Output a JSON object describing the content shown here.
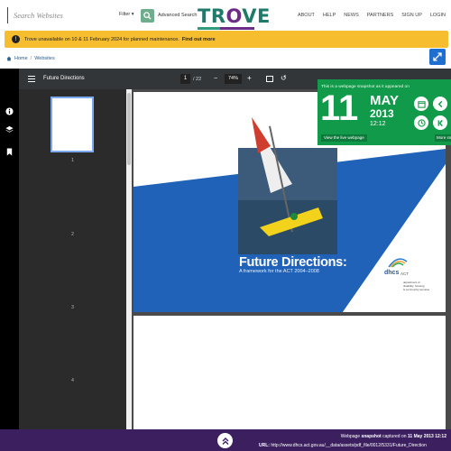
{
  "header": {
    "search_placeholder": "Search Websites",
    "filter_label": "Filter",
    "advanced_search_label": "Advanced Search",
    "logo_left": "TR",
    "logo_o": "O",
    "logo_right": "VE",
    "nav": [
      "ABOUT",
      "HELP",
      "NEWS",
      "PARTNERS",
      "SIGN UP",
      "LOGIN"
    ]
  },
  "alert": {
    "icon": "!",
    "text": "Trove unavailable on 10 & 11 February 2024 for planned maintenance.",
    "link": "Find out more"
  },
  "breadcrumb": {
    "home": "Home",
    "sep": "/",
    "current": "Websites"
  },
  "viewer": {
    "doc_title": "Future Directions",
    "page_current": "1",
    "page_total": "/ 22",
    "zoom": "74%",
    "minus": "−",
    "plus": "+",
    "rotate": "↺",
    "thumb_numbers": [
      "1",
      "2",
      "3",
      "4"
    ]
  },
  "cover": {
    "title": "Future Directions:",
    "subtitle": "A framework for the ACT 2004–2008",
    "dhcs": "dhcs",
    "dhcs_act": "ACT",
    "dhcs_dept": "department of\ndisability, housing\n& community services"
  },
  "snapshot": {
    "heading": "This is a webpage snapshot as it appeared on",
    "day": "11",
    "month": "MAY",
    "year": "2013",
    "time": "12:12",
    "view_live": "View the live webpage",
    "more": "More sn"
  },
  "footer": {
    "captured_prefix": "Webpage",
    "captured_bold": "snapshot",
    "captured_mid": "captured on",
    "captured_date": "11 May 2013 12:12",
    "url_label": "URL:",
    "url": "http://www.dhcs.act.gov.au/__data/assets/pdf_file/0012/5331/Future_Direction"
  },
  "colors": {
    "accent_green": "#109a49",
    "alert_yellow": "#f6bd2f",
    "footer_purple": "#3b1f5e",
    "link_blue": "#2a5e8f"
  }
}
